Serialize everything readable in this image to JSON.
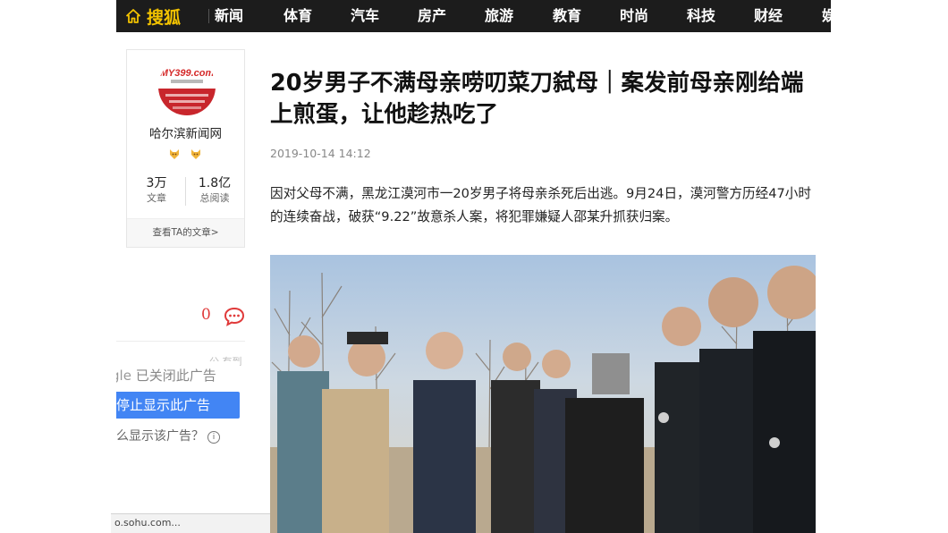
{
  "nav": {
    "logo_text": "搜狐",
    "items": [
      "新闻",
      "体育",
      "汽车",
      "房产",
      "旅游",
      "教育",
      "时尚",
      "科技",
      "财经",
      "娱"
    ]
  },
  "author": {
    "name": "哈尔滨新闻网",
    "avatar_text": "MY399.com",
    "stats": [
      {
        "value": "3万",
        "label": "文章"
      },
      {
        "value": "1.8亿",
        "label": "总阅读"
      }
    ],
    "more_link": "查看TA的文章>"
  },
  "comments": {
    "count": "0"
  },
  "side": {
    "faded_text": "公 有到"
  },
  "ad_overlay": {
    "closed_text": "已关闭此广告",
    "google_fragment": "gle",
    "stop_button": "停止显示此广告",
    "why_text": "么显示该广告？",
    "info_glyph": "i"
  },
  "status_bar": {
    "text": "o.sohu.com..."
  },
  "article": {
    "title": "20岁男子不满母亲唠叨菜刀弑母｜案发前母亲刚给端上煎蛋，让他趁热吃了",
    "date": "2019-10-14 14:12",
    "lead": "因对父母不满，黑龙江漠河市一20岁男子将母亲杀死后出逃。9月24日，漠河警方历经47小时的连续奋战，破获“9.22”故意杀人案，将犯罪嫌疑人邵某升抓获归案。"
  },
  "colors": {
    "nav_bg": "#1c1c1c",
    "logo": "#f3c300",
    "comment_count": "#e03a3a",
    "ad_button": "#4285f4"
  }
}
